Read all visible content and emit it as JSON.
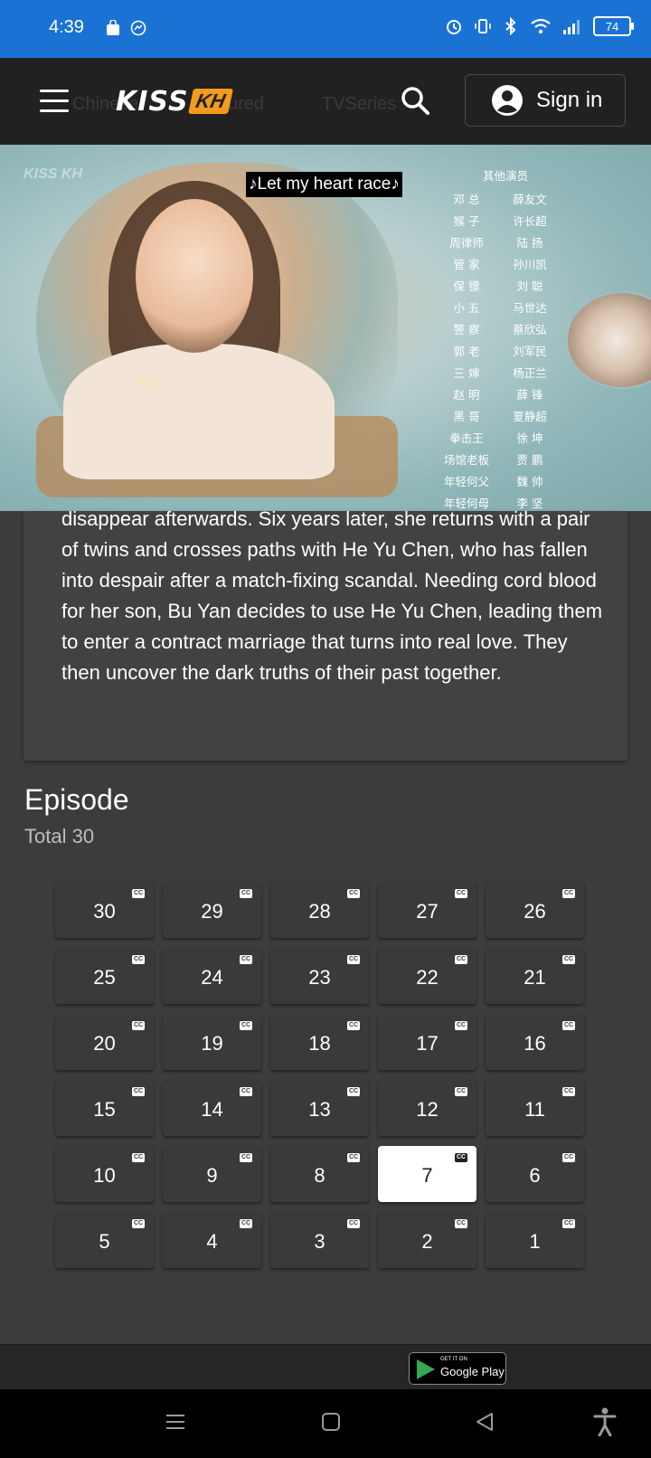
{
  "status_bar": {
    "time": "4:39",
    "battery": "74"
  },
  "header": {
    "logo_main": "KISS",
    "logo_badge": "KH",
    "signin_label": "Sign in",
    "ghost_nav": [
      "Chinese",
      "Featured",
      "TVSeries"
    ]
  },
  "player": {
    "watermark": "KISS KH",
    "subtitle": "♪Let my heart race♪",
    "credit_name": "任 由",
    "credits_heading": "其他演员",
    "credits": [
      [
        "邓 总",
        "薛友文"
      ],
      [
        "猴 子",
        "许长超"
      ],
      [
        "周律师",
        "陆 扬"
      ],
      [
        "管 家",
        "孙川凯"
      ],
      [
        "保 镖",
        "刘 聪"
      ],
      [
        "小 五",
        "马世达"
      ],
      [
        "警 察",
        "蔡欣弘"
      ],
      [
        "郭 老",
        "刘军民"
      ],
      [
        "三 婶",
        "杨正兰"
      ],
      [
        "赵 明",
        "薛 锋"
      ],
      [
        "黑 哥",
        "夏静超"
      ],
      [
        "拳击王",
        "徐 坤"
      ],
      [
        "场馆老板",
        "贾 鹏"
      ],
      [
        "年轻何父",
        "魏 帅"
      ],
      [
        "年轻何母",
        "李 坚"
      ]
    ]
  },
  "description": {
    "text": "disappear afterwards. Six years later, she returns with a pair of twins and crosses paths with He Yu Chen, who has fallen into despair after a match-fixing scandal. Needing cord blood for her son, Bu Yan decides to use He Yu Chen, leading them to enter a contract marriage that turns into real love. They then uncover the dark truths of their past together."
  },
  "episodes": {
    "heading": "Episode",
    "total": "Total 30",
    "cc_label": "CC",
    "list": [
      "30",
      "29",
      "28",
      "27",
      "26",
      "25",
      "24",
      "23",
      "22",
      "21",
      "20",
      "19",
      "18",
      "17",
      "16",
      "15",
      "14",
      "13",
      "12",
      "11",
      "10",
      "9",
      "8",
      "7",
      "6",
      "5",
      "4",
      "3",
      "2",
      "1"
    ],
    "active": "7"
  },
  "footer": {
    "gplay_small": "GET IT ON",
    "gplay_big": "Google Play"
  },
  "colors": {
    "status_bar": "#1a73d4",
    "header": "#212121",
    "page_bg": "#3c3c3c",
    "logo_accent": "#f29b1c"
  }
}
